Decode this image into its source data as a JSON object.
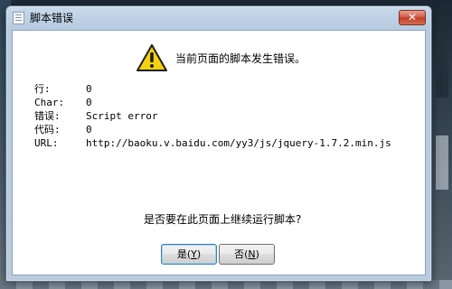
{
  "dialog": {
    "title": "脚本错误",
    "close_label": "✕",
    "headline": "当前页面的脚本发生错误。",
    "fields": {
      "line": {
        "label": "行:",
        "value": "0"
      },
      "char": {
        "label": "Char:",
        "value": "0"
      },
      "error": {
        "label": "错误:",
        "value": "Script error"
      },
      "code": {
        "label": "代码:",
        "value": "0"
      },
      "url": {
        "label": "URL:",
        "value": "http://baoku.v.baidu.com/yy3/js/jquery-1.7.2.min.js"
      }
    },
    "question": "是否要在此页面上继续运行脚本?",
    "buttons": {
      "yes": {
        "label": "是(",
        "key": "Y",
        "tail": ")"
      },
      "no": {
        "label": "否(",
        "key": "N",
        "tail": ")"
      }
    }
  },
  "icons": {
    "title": "script-error-window-icon",
    "warning": "warning-triangle-icon",
    "close": "close-icon"
  },
  "colors": {
    "close_button": "#c8442c",
    "warning_fill": "#f5d20f",
    "frame": "#b9cbdd"
  }
}
